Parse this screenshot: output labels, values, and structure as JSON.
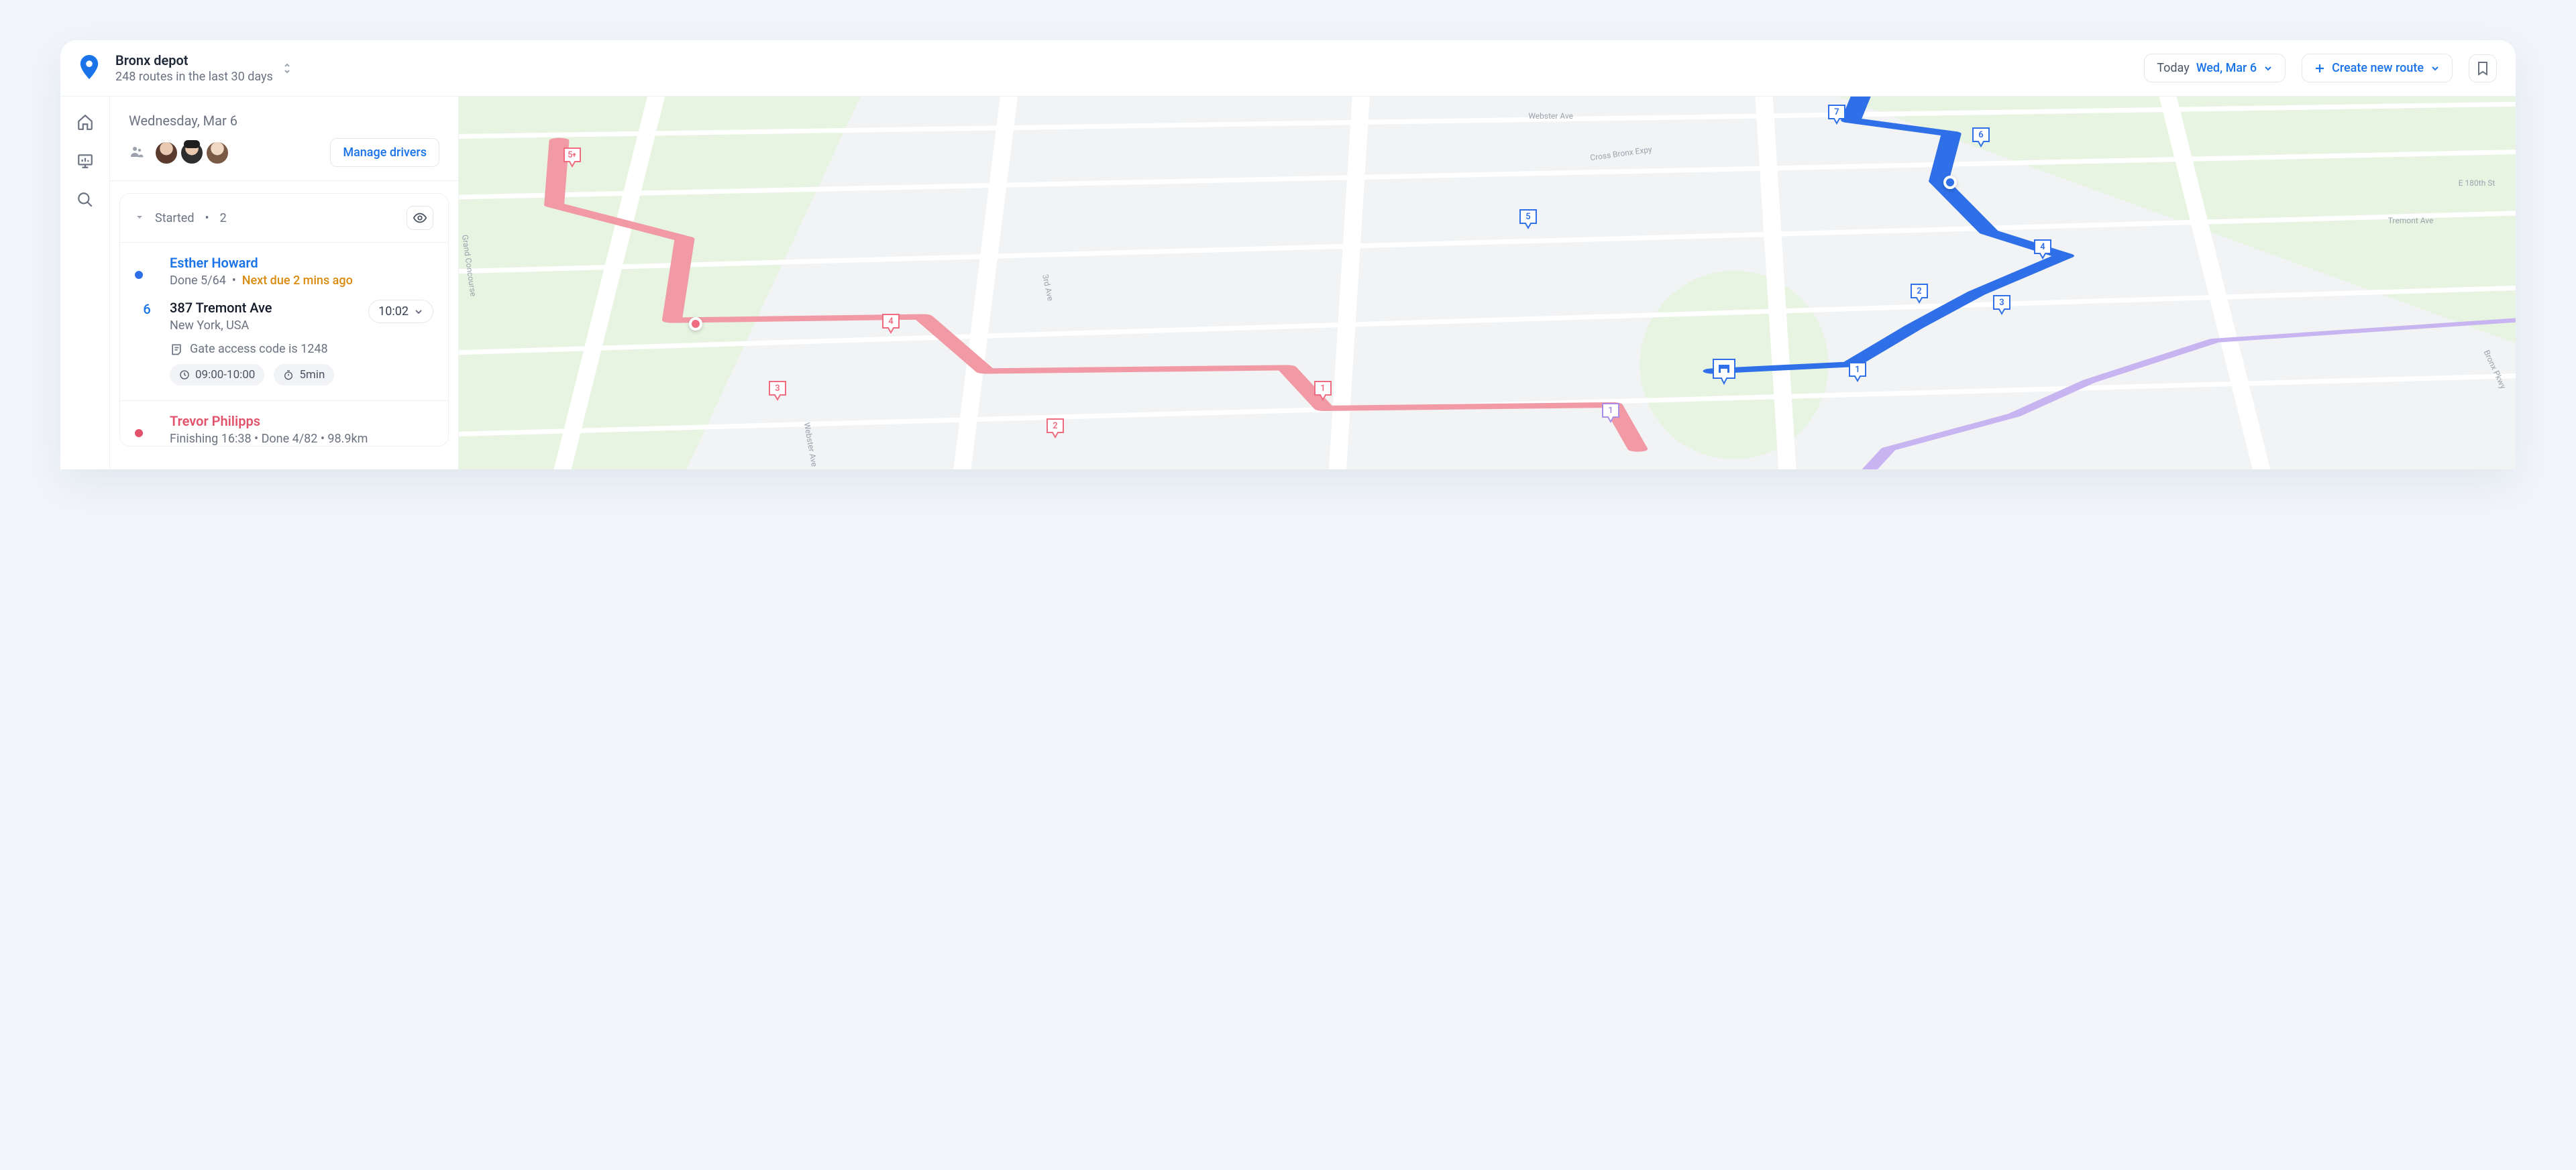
{
  "header": {
    "depot_name": "Bronx depot",
    "depot_sub": "248 routes in the last 30 days",
    "date_label_prefix": "Today",
    "date_label_value": "Wed, Mar 6",
    "create_route_label": "Create new route"
  },
  "panel": {
    "date_heading": "Wednesday, Mar 6",
    "manage_drivers_label": "Manage drivers",
    "group": {
      "title": "Started",
      "count": "2"
    },
    "drivers": [
      {
        "name": "Esther Howard",
        "progress": "Done 5/64",
        "alert": "Next due 2 mins ago",
        "stop": {
          "index": "6",
          "address_line1": "387 Tremont Ave",
          "address_line2": "New York, USA",
          "eta": "10:02",
          "note": "Gate access code is 1248",
          "window": "09:00-10:00",
          "duration": "5min"
        }
      },
      {
        "name": "Trevor Philipps",
        "subline": "Finishing 16:38  •  Done 4/82  •  98.9km"
      }
    ]
  },
  "map": {
    "street_labels": [
      "Webster Ave",
      "Cross Bronx Expy",
      "E 180th St",
      "Tremont Ave",
      "3rd Ave",
      "Grand Concourse",
      "Bronx Pkwy",
      "Webster Ave"
    ],
    "blue_stops": [
      "7",
      "6",
      "5",
      "4",
      "2",
      "3",
      "1"
    ],
    "pink_stops": [
      "5",
      "4",
      "3",
      "1",
      "2"
    ],
    "purple_stops": [
      "1"
    ]
  }
}
